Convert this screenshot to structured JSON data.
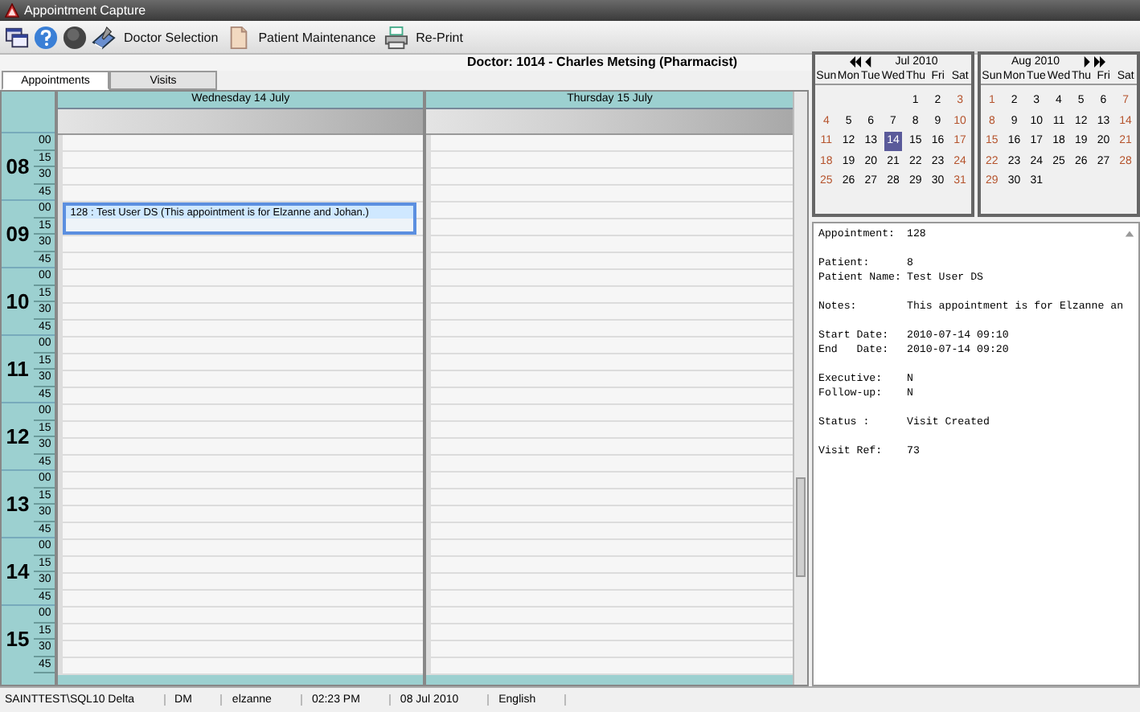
{
  "window": {
    "title": "Appointment Capture"
  },
  "toolbar": [
    "Doctor Selection",
    "Patient Maintenance",
    "Re-Print"
  ],
  "doctor": "Doctor: 1014 - Charles Metsing (Pharmacist)",
  "tabs": [
    {
      "label": "Appointments",
      "selected": true
    },
    {
      "label": "Visits",
      "selected": false
    }
  ],
  "schedule": {
    "days": [
      {
        "title": "Wednesday 14 July"
      },
      {
        "title": "Thursday 15 July"
      }
    ],
    "hours": [
      {
        "hour": "08",
        "minutes": [
          "00",
          "15",
          "30",
          "45"
        ]
      },
      {
        "hour": "09",
        "minutes": [
          "00",
          "15",
          "30",
          "45"
        ],
        "appointments": [
          {
            "text": "128 : Test User DS (This appointment is for Elzanne and Johan.)"
          }
        ]
      },
      {
        "hour": "10",
        "minutes": [
          "00",
          "15",
          "30",
          "45"
        ]
      },
      {
        "hour": "11",
        "minutes": [
          "00",
          "15",
          "30",
          "45"
        ]
      },
      {
        "hour": "12",
        "minutes": [
          "00",
          "15",
          "30",
          "45"
        ]
      },
      {
        "hour": "13",
        "minutes": [
          "00",
          "15",
          "30",
          "45"
        ]
      },
      {
        "hour": "14",
        "minutes": [
          "00",
          "15",
          "30",
          "45"
        ]
      },
      {
        "hour": "15",
        "minutes": [
          "00",
          "15",
          "30",
          "45"
        ]
      }
    ]
  },
  "calendars": [
    {
      "title": "Jul 2010",
      "weekdays": [
        "Sun",
        "Mon",
        "Tue",
        "Wed",
        "Thu",
        "Fri",
        "Sat"
      ],
      "weeks": [
        [
          {
            "day": "1",
            "selected": false
          },
          {
            "day": "2",
            "selected": false
          },
          {
            "day": "3",
            "selected": false
          }
        ],
        [
          {
            "day": "4",
            "selected": false
          },
          {
            "day": "5",
            "selected": false
          },
          {
            "day": "6",
            "selected": false
          },
          {
            "day": "7",
            "selected": false
          },
          {
            "day": "8",
            "selected": false
          },
          {
            "day": "9",
            "selected": false
          },
          {
            "day": "10",
            "selected": false
          }
        ],
        [
          {
            "day": "11",
            "selected": false
          },
          {
            "day": "12",
            "selected": false
          },
          {
            "day": "13",
            "selected": false
          },
          {
            "day": "14",
            "selected": true
          },
          {
            "day": "15",
            "selected": false
          },
          {
            "day": "16",
            "selected": false
          },
          {
            "day": "17",
            "selected": false
          }
        ],
        [
          {
            "day": "18",
            "selected": false
          },
          {
            "day": "19",
            "selected": false
          },
          {
            "day": "20",
            "selected": false
          },
          {
            "day": "21",
            "selected": false
          },
          {
            "day": "22",
            "selected": false
          },
          {
            "day": "23",
            "selected": false
          },
          {
            "day": "24",
            "selected": false
          }
        ],
        [
          {
            "day": "25",
            "selected": false
          },
          {
            "day": "26",
            "selected": false
          },
          {
            "day": "27",
            "selected": false
          },
          {
            "day": "28",
            "selected": false
          },
          {
            "day": "29",
            "selected": false
          },
          {
            "day": "30",
            "selected": false
          },
          {
            "day": "31",
            "selected": false
          }
        ]
      ]
    },
    {
      "title": "Aug 2010",
      "weekdays": [
        "Sun",
        "Mon",
        "Tue",
        "Wed",
        "Thu",
        "Fri",
        "Sat"
      ],
      "weeks": [
        [
          {
            "day": "1",
            "selected": false
          },
          {
            "day": "2",
            "selected": false
          },
          {
            "day": "3",
            "selected": false
          },
          {
            "day": "4",
            "selected": false
          },
          {
            "day": "5",
            "selected": false
          },
          {
            "day": "6",
            "selected": false
          },
          {
            "day": "7",
            "selected": false
          }
        ],
        [
          {
            "day": "8",
            "selected": false
          },
          {
            "day": "9",
            "selected": false
          },
          {
            "day": "10",
            "selected": false
          },
          {
            "day": "11",
            "selected": false
          },
          {
            "day": "12",
            "selected": false
          },
          {
            "day": "13",
            "selected": false
          },
          {
            "day": "14",
            "selected": false
          }
        ],
        [
          {
            "day": "15",
            "selected": false
          },
          {
            "day": "16",
            "selected": false
          },
          {
            "day": "17",
            "selected": false
          },
          {
            "day": "18",
            "selected": false
          },
          {
            "day": "19",
            "selected": false
          },
          {
            "day": "20",
            "selected": false
          },
          {
            "day": "21",
            "selected": false
          }
        ],
        [
          {
            "day": "22",
            "selected": false
          },
          {
            "day": "23",
            "selected": false
          },
          {
            "day": "24",
            "selected": false
          },
          {
            "day": "25",
            "selected": false
          },
          {
            "day": "26",
            "selected": false
          },
          {
            "day": "27",
            "selected": false
          },
          {
            "day": "28",
            "selected": false
          }
        ],
        [
          {
            "day": "29",
            "selected": false
          },
          {
            "day": "30",
            "selected": false
          },
          {
            "day": "31",
            "selected": false
          }
        ]
      ]
    }
  ],
  "details": [
    [
      {
        "label": "Appointment:",
        "value": "128"
      }
    ],
    [
      {
        "label": "Patient:",
        "value": "8"
      },
      {
        "label": "Patient Name:",
        "value": "Test User DS"
      }
    ],
    [
      {
        "label": "Notes:",
        "value": "This appointment is for Elzanne an"
      }
    ],
    [
      {
        "label": "Start Date:",
        "value": "2010-07-14 09:10"
      },
      {
        "label": "End   Date:",
        "value": "2010-07-14 09:20"
      }
    ],
    [
      {
        "label": "Executive:",
        "value": "N"
      },
      {
        "label": "Follow-up:",
        "value": "N"
      }
    ],
    [
      {
        "label": "Status :",
        "value": "Visit Created"
      }
    ],
    [
      {
        "label": "Visit Ref:",
        "value": "73"
      }
    ]
  ],
  "status_bar": [
    "SAINTTEST\\SQL10 Delta",
    "DM",
    "elzanne",
    "02:23 PM",
    "08 Jul 2010",
    "English"
  ]
}
